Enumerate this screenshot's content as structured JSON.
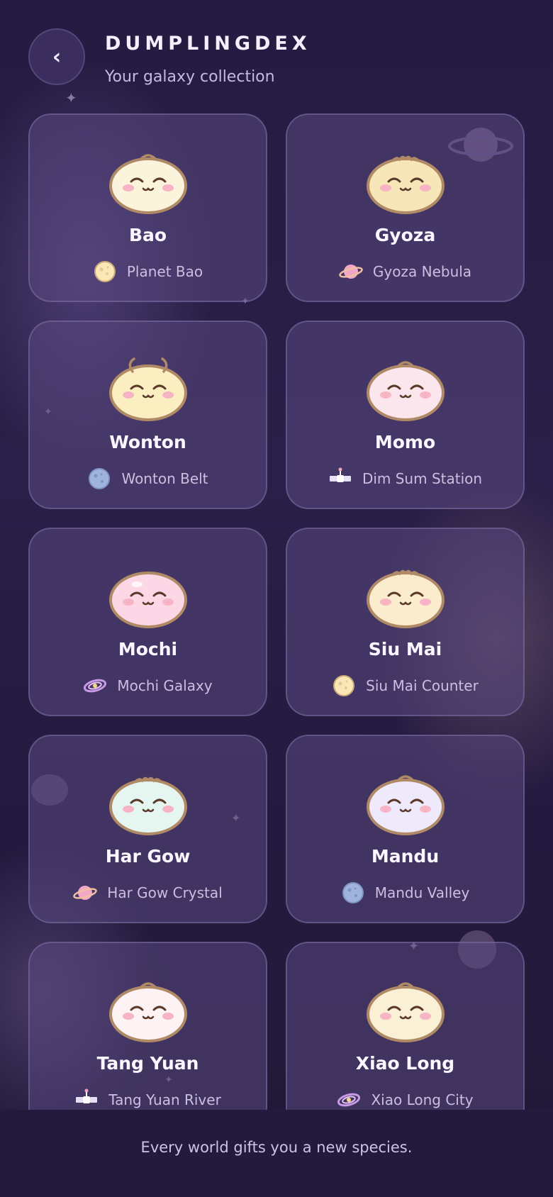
{
  "header": {
    "back_icon": "chevron-left-icon",
    "title": "DUMPLINGDEX",
    "subtitle": "Your galaxy collection"
  },
  "dumplings": [
    {
      "name": "Bao",
      "world": "Planet Bao",
      "world_icon": "moon-icon",
      "body_color": "#fbf3dc"
    },
    {
      "name": "Gyoza",
      "world": "Gyoza Nebula",
      "world_icon": "ringed-planet-icon",
      "body_color": "#f6e6b8"
    },
    {
      "name": "Wonton",
      "world": "Wonton Belt",
      "world_icon": "asteroid-icon",
      "body_color": "#fbefc2"
    },
    {
      "name": "Momo",
      "world": "Dim Sum Station",
      "world_icon": "satellite-icon",
      "body_color": "#fbe6ee"
    },
    {
      "name": "Mochi",
      "world": "Mochi Galaxy",
      "world_icon": "galaxy-icon",
      "body_color": "#fcd7e6"
    },
    {
      "name": "Siu Mai",
      "world": "Siu Mai Counter",
      "world_icon": "moon-icon",
      "body_color": "#fbeccd"
    },
    {
      "name": "Har Gow",
      "world": "Har Gow Crystal",
      "world_icon": "ringed-planet-icon",
      "body_color": "#e4f6ef"
    },
    {
      "name": "Mandu",
      "world": "Mandu Valley",
      "world_icon": "asteroid-icon",
      "body_color": "#efeafb"
    },
    {
      "name": "Tang Yuan",
      "world": "Tang Yuan River",
      "world_icon": "satellite-icon",
      "body_color": "#fdf2f4"
    },
    {
      "name": "Xiao Long",
      "world": "Xiao Long City",
      "world_icon": "galaxy-icon",
      "body_color": "#f9f0d6"
    }
  ],
  "footer": {
    "text": "Every world gifts you a new species."
  },
  "colors": {
    "background": "#241a3e",
    "card": "#4a3a6e",
    "outline": "#b08a66",
    "cheek": "#f7b4c4"
  }
}
